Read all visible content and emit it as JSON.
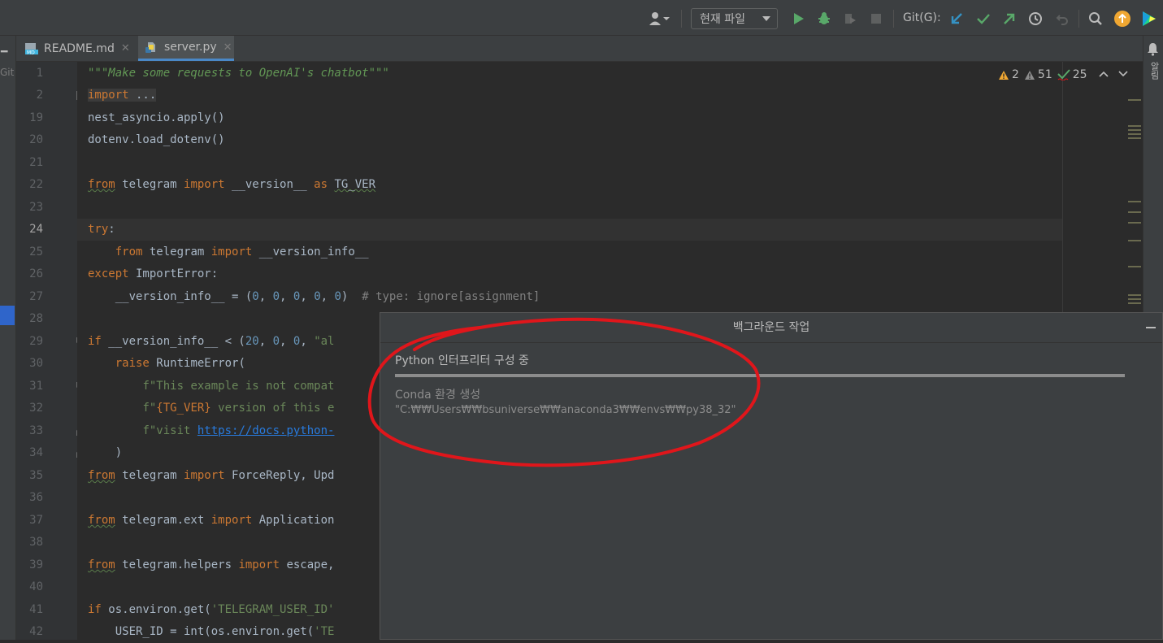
{
  "toolbar": {
    "config_select": "현재 파일",
    "git_label": "Git(G):"
  },
  "tabs": [
    {
      "label": "README.md",
      "close": "✕",
      "icon": "markdown-file-icon"
    },
    {
      "label": "server.py",
      "close": "✕",
      "icon": "python-file-icon"
    }
  ],
  "left_strip": {
    "git_label": "Git"
  },
  "right_strip": {
    "label": "알림"
  },
  "inspections": {
    "errors": "2",
    "warnings": "51",
    "typos": "25"
  },
  "gutter": {
    "line_numbers": [
      "1",
      "2",
      "19",
      "20",
      "21",
      "22",
      "23",
      "24",
      "25",
      "26",
      "27",
      "28",
      "29",
      "30",
      "31",
      "32",
      "33",
      "34",
      "35",
      "36",
      "37",
      "38",
      "39",
      "40",
      "41",
      "42"
    ],
    "current_line": "24"
  },
  "code": {
    "l1": "\"\"\"Make some requests to OpenAI's chatbot\"\"\"",
    "l2_kw": "import",
    "l2_fold": " ...",
    "l19": "nest_asyncio.apply()",
    "l20": "dotenv.load_dotenv()",
    "l22_from": "from",
    "l22_mod": " telegram ",
    "l22_import": "import",
    "l22_name": " __version__ ",
    "l22_as": "as",
    "l22_alias": "TG_VER",
    "l24_try": "try",
    "l24_colon": ":",
    "l25_indent": "    ",
    "l25_from": "from",
    "l25_mod": " telegram ",
    "l25_import": "import",
    "l25_name": " __version_info__",
    "l26_except": "except",
    "l26_rest": " ImportError:",
    "l27_a": "    __version_info__ = (",
    "l27_n1": "0",
    "l27_n2": "0",
    "l27_n3": "0",
    "l27_n4": "0",
    "l27_n5": "0",
    "l27_close": ")",
    "l27_cmt": "# type: ignore[assignment]",
    "l29_if": "if",
    "l29_a": " __version_info__ < (",
    "l29_n1": "20",
    "l29_n2": "0",
    "l29_n3": "0",
    "l29_str": "\"al",
    "l30_raise": "raise",
    "l30_rest": " RuntimeError(",
    "l31_str": "f\"This example is not compat",
    "l32_f": "f\"",
    "l32_var": "{TG_VER}",
    "l32_str": " version of this e",
    "l33_str": "f\"visit ",
    "l33_link": "https://docs.python-",
    "l34": ")",
    "l35_from": "from",
    "l35_rest": " telegram ",
    "l35_import": "import",
    "l35_names": " ForceReply, Upd",
    "l37_from": "from",
    "l37_rest": " telegram.ext ",
    "l37_import": "import",
    "l37_names": " Application",
    "l39_from": "from",
    "l39_rest": " telegram.helpers ",
    "l39_import": "import",
    "l39_names": " escape,",
    "l41_if": "if",
    "l41_rest": " os.environ.get(",
    "l41_str": "'TELEGRAM_USER_ID'",
    "l42_a": "    USER_ID = int(os.environ.get(",
    "l42_str": "'TE"
  },
  "popup": {
    "title": "백그라운드 작업",
    "task_title": "Python 인터프리터 구성 중",
    "progress_fraction": 1.0,
    "task_sub": "Conda 환경 생성",
    "task_detail": "\"C:₩₩Users₩₩bsuniverse₩₩anaconda3₩₩envs₩₩py38_32\""
  },
  "colors": {
    "accent": "#4a88c7",
    "annotation": "#e0161b",
    "run_green": "#59a869",
    "git_blue": "#3592c4"
  }
}
